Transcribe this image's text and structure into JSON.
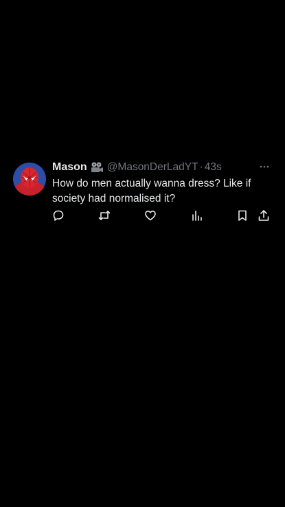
{
  "tweet": {
    "author_name": "Mason",
    "badge_icon": "film-camera-emoji",
    "handle": "@MasonDerLadYT",
    "separator": "·",
    "time": "43s",
    "text": "How do men actually wanna dress? Like if society had normalised it?",
    "more_icon": "more-options-icon"
  },
  "actions": [
    {
      "name": "reply-icon"
    },
    {
      "name": "retweet-icon"
    },
    {
      "name": "like-icon"
    },
    {
      "name": "views-icon"
    },
    {
      "name": "bookmark-icon"
    },
    {
      "name": "share-icon"
    }
  ],
  "colors": {
    "background": "#000000",
    "primary_text": "#e7e9ea",
    "secondary_text": "#71767b"
  }
}
